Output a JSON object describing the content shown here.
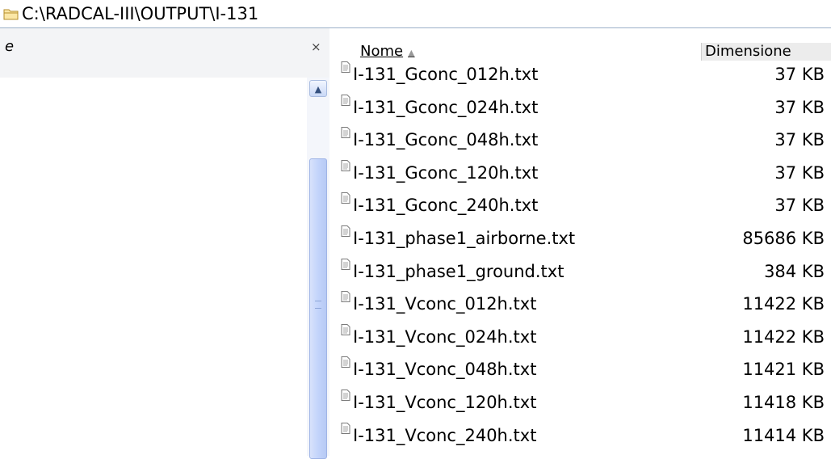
{
  "address": {
    "path": "C:\\RADCAL-III\\OUTPUT\\I-131"
  },
  "left_pane": {
    "label": "e",
    "close_label": "×"
  },
  "columns": {
    "name": "Nome",
    "size": "Dimensione"
  },
  "files": [
    {
      "name": "I-131_Gconc_012h.txt",
      "size": "37 KB"
    },
    {
      "name": "I-131_Gconc_024h.txt",
      "size": "37 KB"
    },
    {
      "name": "I-131_Gconc_048h.txt",
      "size": "37 KB"
    },
    {
      "name": "I-131_Gconc_120h.txt",
      "size": "37 KB"
    },
    {
      "name": "I-131_Gconc_240h.txt",
      "size": "37 KB"
    },
    {
      "name": "I-131_phase1_airborne.txt",
      "size": "85686 KB"
    },
    {
      "name": "I-131_phase1_ground.txt",
      "size": "384 KB"
    },
    {
      "name": "I-131_Vconc_012h.txt",
      "size": "11422 KB"
    },
    {
      "name": "I-131_Vconc_024h.txt",
      "size": "11422 KB"
    },
    {
      "name": "I-131_Vconc_048h.txt",
      "size": "11421 KB"
    },
    {
      "name": "I-131_Vconc_120h.txt",
      "size": "11418 KB"
    },
    {
      "name": "I-131_Vconc_240h.txt",
      "size": "11414 KB"
    }
  ]
}
